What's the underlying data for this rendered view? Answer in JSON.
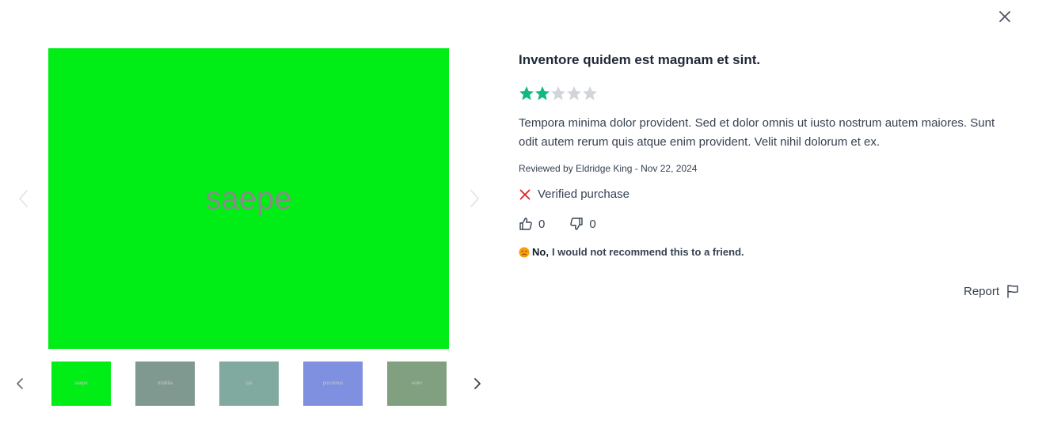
{
  "modal": {
    "close_icon": "close-icon"
  },
  "gallery": {
    "main_image": {
      "label": "saepe",
      "color": "#00ee16"
    },
    "thumbnails": [
      {
        "label": "saepe",
        "color": "#00ee16"
      },
      {
        "label": "mollitia",
        "color": "#809990"
      },
      {
        "label": "qui",
        "color": "#80aaa0"
      },
      {
        "label": "possimus",
        "color": "#8090e0"
      },
      {
        "label": "enim",
        "color": "#80a080"
      }
    ]
  },
  "review": {
    "title": "Inventore quidem est magnam et sint.",
    "rating": 2,
    "rating_max": 5,
    "star_color": "#10b981",
    "star_empty_color": "#d1d5db",
    "body": "Tempora minima dolor provident. Sed et dolor omnis ut iusto nostrum autem maiores. Sunt odit autem rerum quis atque enim provident. Velit nihil dolorum et ex.",
    "reviewer_line": "Reviewed by Eldridge King - Nov 22, 2024",
    "verified_label": "Verified purchase",
    "verified_icon_color": "#dc2626",
    "helpful_count": "0",
    "not_helpful_count": "0",
    "recommend_no": "No,",
    "recommend_text": "I would not recommend this to a friend.",
    "report_label": "Report"
  }
}
